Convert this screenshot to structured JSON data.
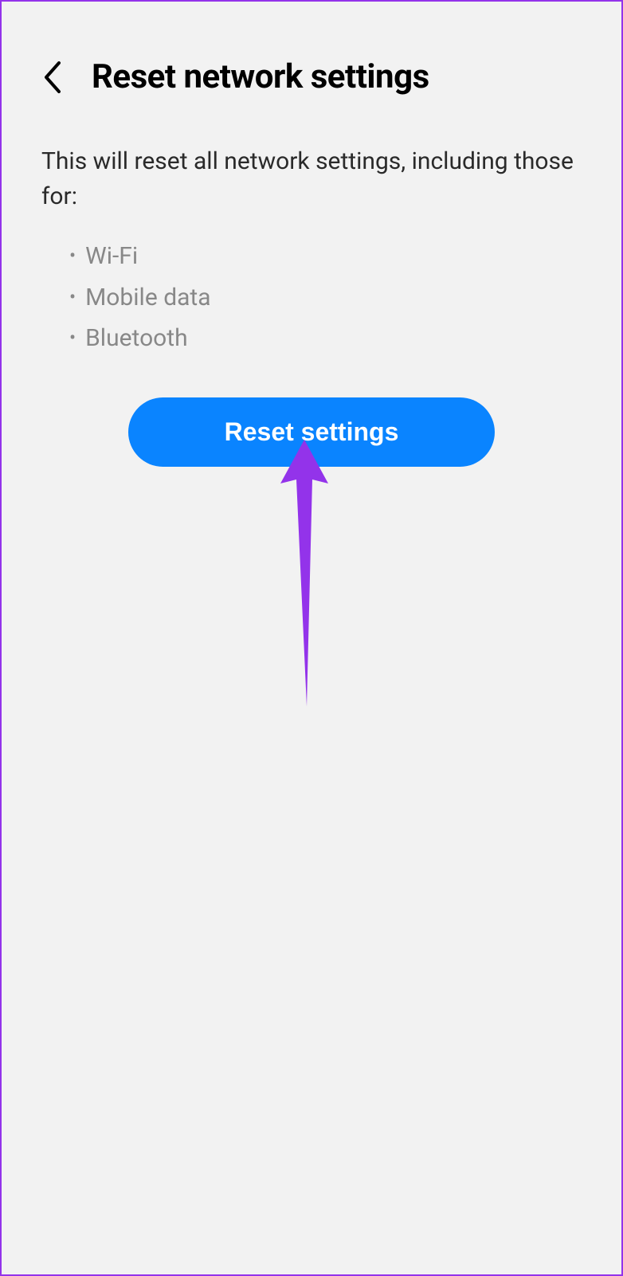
{
  "header": {
    "title": "Reset network settings"
  },
  "content": {
    "description": "This will reset all network settings, including those for:",
    "bullets": [
      "Wi-Fi",
      "Mobile data",
      "Bluetooth"
    ]
  },
  "button": {
    "reset_label": "Reset settings"
  },
  "annotation": {
    "arrow_color": "#9333ea"
  }
}
